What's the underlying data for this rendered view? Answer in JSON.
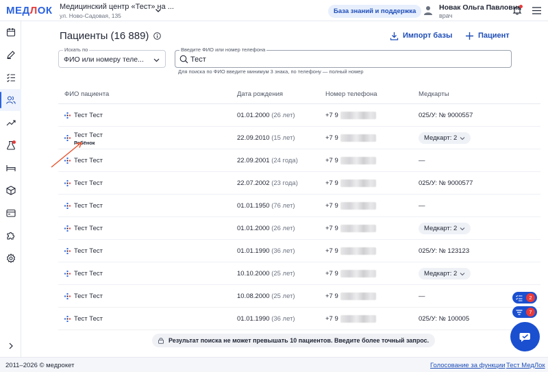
{
  "header": {
    "logo": "МЕДЛОК",
    "org_name": "Медицинский центр «Тест» на ...",
    "org_address": "ул. Ново-Садовая, 135",
    "knowledge_base_label": "База знаний и поддержка",
    "user_name": "Новак Ольга Павловна",
    "user_role": "врач"
  },
  "page": {
    "title": "Пациенты (16 889)",
    "import_label": "Импорт базы",
    "add_label": "Пациент"
  },
  "search": {
    "by_label": "Искать по",
    "by_value": "ФИО или номеру теле...",
    "input_label": "Введите ФИО или номер телефона",
    "input_value": "Тест",
    "hint": "Для поиска по ФИО введите минимум 3 знака, по телефону — полный номер"
  },
  "table": {
    "headers": [
      "ФИО пациента",
      "Дата рождения",
      "Номер телефона",
      "Медкарты"
    ],
    "rows": [
      {
        "name": "Тест Тест",
        "sub": "",
        "dob": "01.01.2000",
        "age": "(26 лет)",
        "phone": "+7 9",
        "card": "025/У: № 9000557",
        "card_badge": ""
      },
      {
        "name": "Тест Тест",
        "sub": "Ребёнок",
        "dob": "22.09.2010",
        "age": "(15 лет)",
        "phone": "+7 9",
        "card": "",
        "card_badge": "Медкарт: 2"
      },
      {
        "name": "Тест Тест",
        "sub": "",
        "dob": "22.09.2001",
        "age": "(24 года)",
        "phone": "+7 9",
        "card": "—",
        "card_badge": ""
      },
      {
        "name": "Тест Тест",
        "sub": "",
        "dob": "22.07.2002",
        "age": "(23 года)",
        "phone": "+7 9",
        "card": "025/У: № 9000577",
        "card_badge": ""
      },
      {
        "name": "Тест Тест",
        "sub": "",
        "dob": "01.01.1950",
        "age": "(76 лет)",
        "phone": "+7 9",
        "card": "—",
        "card_badge": ""
      },
      {
        "name": "Тест Тест",
        "sub": "",
        "dob": "01.01.2000",
        "age": "(26 лет)",
        "phone": "+7 9",
        "card": "",
        "card_badge": "Медкарт: 2"
      },
      {
        "name": "Тест Тест",
        "sub": "",
        "dob": "01.01.1990",
        "age": "(36 лет)",
        "phone": "+7 9",
        "card": "025/У: № 123123",
        "card_badge": ""
      },
      {
        "name": "Тест Тест",
        "sub": "",
        "dob": "10.10.2000",
        "age": "(25 лет)",
        "phone": "+7 9",
        "card": "",
        "card_badge": "Медкарт: 2"
      },
      {
        "name": "Тест Тест",
        "sub": "",
        "dob": "10.08.2000",
        "age": "(25 лет)",
        "phone": "+7 9",
        "card": "—",
        "card_badge": ""
      },
      {
        "name": "Тест Тест",
        "sub": "",
        "dob": "01.01.1990",
        "age": "(36 лет)",
        "phone": "+7 9",
        "card": "025/У: № 100005",
        "card_badge": ""
      }
    ]
  },
  "notice": "Результат поиска не может превышать 10 пациентов. Введите более точный запрос.",
  "fabs": {
    "tasks_count": "2",
    "filters_count": "7"
  },
  "footer": {
    "copyright": "2011–2026 © медрокет",
    "vote_link": "Голосование за функции",
    "test_link": "Тест МедЛок"
  },
  "colors": {
    "accent": "#1a4fd0",
    "link": "#1e4db7",
    "alert": "#e83b3b",
    "annotation_arrow": "#e8502a"
  },
  "icons": [
    "calendar-icon",
    "pen-icon",
    "checklist-icon",
    "users-icon",
    "chart-icon",
    "flask-icon",
    "bed-icon",
    "box-icon",
    "cash-register-icon",
    "puzzle-icon",
    "gear-icon"
  ]
}
